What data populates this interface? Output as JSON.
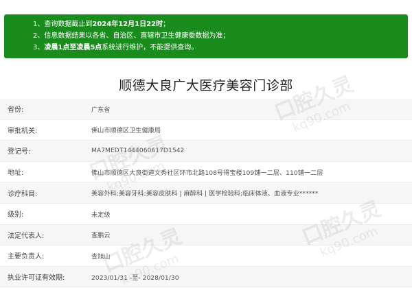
{
  "notice": {
    "line1_prefix": "1、查询数据截止到",
    "line1_bold": "2024年12月1日22时",
    "line1_suffix": "；",
    "line2": "2、信息数据结果以各省、自治区、直辖市卫生健康委数据为准；",
    "line3_prefix": "3、",
    "line3_bold": "凌晨1点至凌晨5点",
    "line3_suffix": "系统进行维护，不能提供查询。"
  },
  "title": "顺德大良广大医疗美容门诊部",
  "fields": [
    {
      "label": "省份:",
      "value": "广东省"
    },
    {
      "label": "审批机关:",
      "value": "佛山市顺德区卫生健康局"
    },
    {
      "label": "登记号:",
      "value": "MA7MEDT1444060617D1542"
    },
    {
      "label": "地址:",
      "value": "佛山市顺德区大良街道文秀社区环市北路108号得宝楼109铺一二层、110铺一二层"
    },
    {
      "label": "诊疗科目:",
      "value": "美容外科;美容牙科;美容皮肤科 | 麻醉科 | 医学检验科;临床体液、血液专业******"
    },
    {
      "label": "级别:",
      "value": "未定级"
    },
    {
      "label": "法定代表人:",
      "value": "查鹏云"
    },
    {
      "label": "主要负责人:",
      "value": "查旭山"
    },
    {
      "label": "执业许可证有效期:",
      "value": "2023/01/31 -至- 2028/01/30"
    }
  ],
  "watermark": {
    "main": "口腔久灵",
    "sub": "kq90.com"
  },
  "colors": {
    "notice_bg": "#1a8c1d",
    "shaded_row": "#f6f6f6"
  }
}
